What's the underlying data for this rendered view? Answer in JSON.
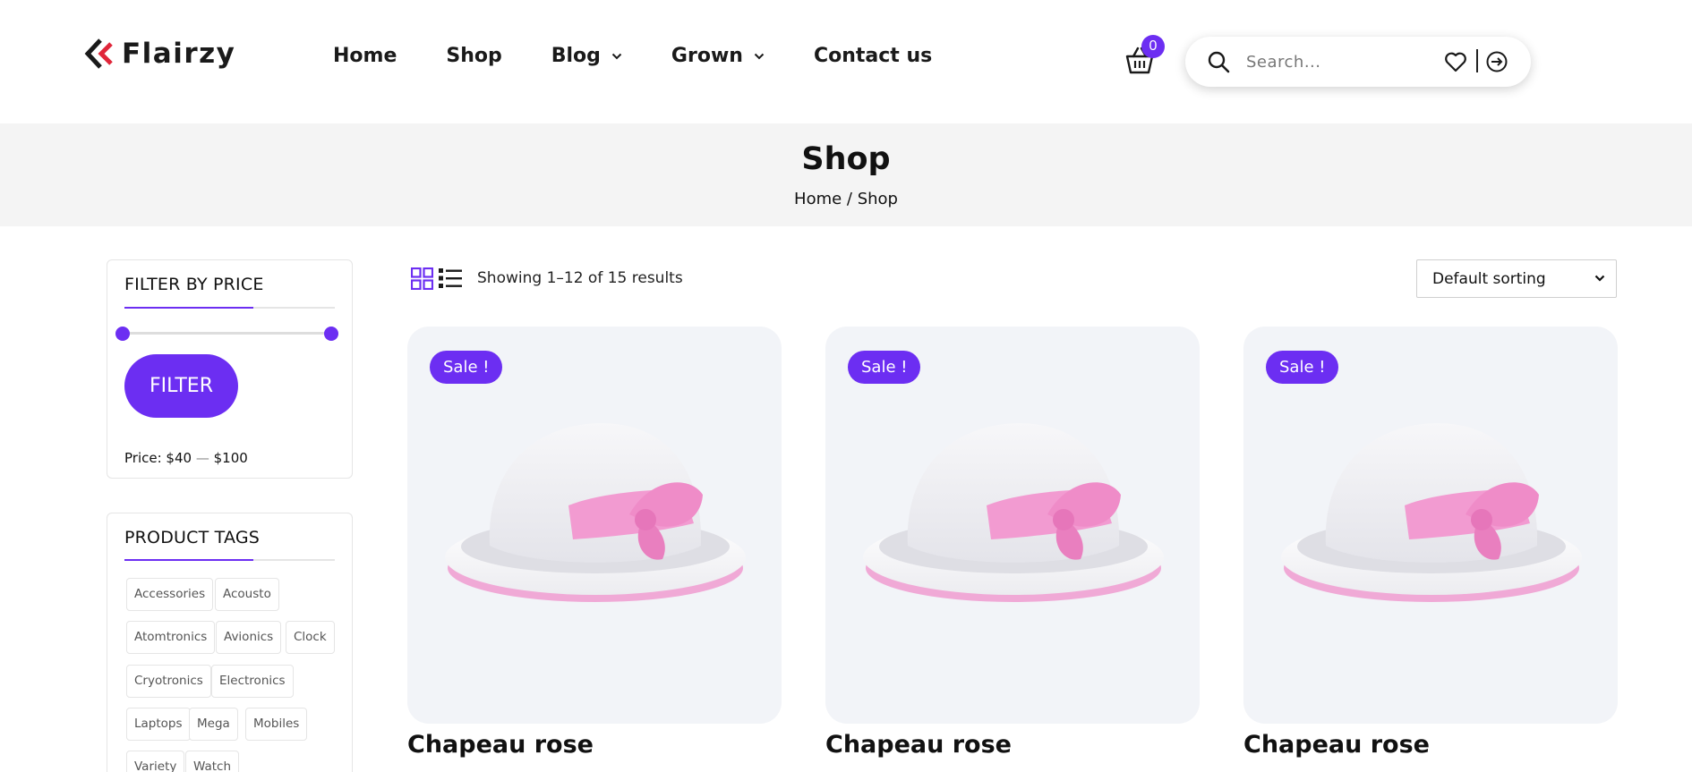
{
  "header": {
    "logo_text": "Flairzy",
    "nav": [
      {
        "label": "Home",
        "has_dropdown": false
      },
      {
        "label": "Shop",
        "has_dropdown": false
      },
      {
        "label": "Blog",
        "has_dropdown": true
      },
      {
        "label": "Grown",
        "has_dropdown": true
      },
      {
        "label": "Contact us",
        "has_dropdown": false
      }
    ],
    "cart_count": "0",
    "search_placeholder": "Search..."
  },
  "banner": {
    "title": "Shop",
    "breadcrumb": "Home / Shop"
  },
  "sidebar": {
    "price_filter": {
      "title": "FILTER BY PRICE",
      "button_label": "FILTER",
      "price_prefix": "Price: ",
      "min_price": "$40",
      "separator": " — ",
      "max_price": "$100",
      "slider_min_fraction": 0,
      "slider_max_fraction": 1
    },
    "product_tags": {
      "title": "PRODUCT TAGS",
      "tags": [
        "Accessories",
        "Acousto",
        "Atomtronics",
        "Avionics",
        "Clock",
        "Cryotronics",
        "Electronics",
        "Laptops",
        "Mega",
        "Mobiles",
        "Variety",
        "Watch"
      ]
    }
  },
  "toolbar": {
    "results_text": "Showing 1–12 of 15 results",
    "sort_label": "Default sorting"
  },
  "products": [
    {
      "name": "Chapeau rose",
      "badge": "Sale !"
    },
    {
      "name": "Chapeau rose",
      "badge": "Sale !"
    },
    {
      "name": "Chapeau rose",
      "badge": "Sale !"
    }
  ],
  "colors": {
    "accent": "#6c2ef2",
    "logo_red": "#e0263a",
    "card_bg": "#f2f4f8",
    "banner_bg": "#f4f4f4"
  },
  "icons": {
    "cart": "basket-icon",
    "search": "search-icon",
    "wishlist": "heart-icon",
    "account": "sign-in-icon",
    "grid_view": "grid-view-icon",
    "list_view": "list-view-icon"
  }
}
